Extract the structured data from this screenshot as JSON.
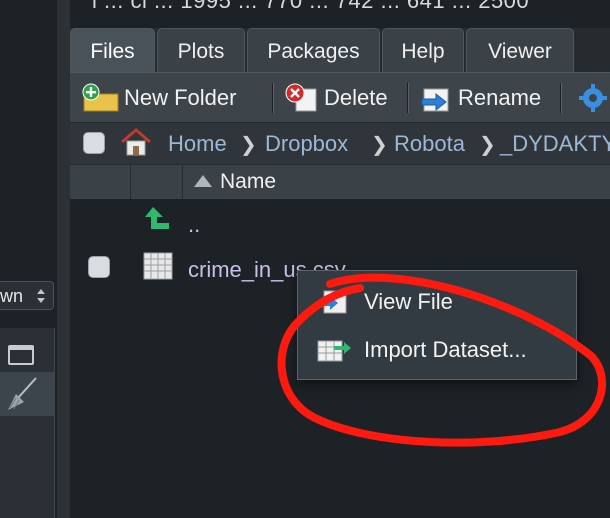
{
  "top_partial_text": "i ... ci ... 1995 ... 770 ... 742 ... 641 ... 2500",
  "left_pane": {
    "select_value": "wn",
    "window_icon": "window-icon",
    "broom_icon": "broom-icon"
  },
  "tabs": [
    {
      "label": "Files",
      "active": true
    },
    {
      "label": "Plots",
      "active": false
    },
    {
      "label": "Packages",
      "active": false
    },
    {
      "label": "Help",
      "active": false
    },
    {
      "label": "Viewer",
      "active": false
    }
  ],
  "toolbar": {
    "new_folder_label": "New Folder",
    "new_folder_icon": "new-folder-icon",
    "delete_label": "Delete",
    "delete_icon": "delete-icon",
    "rename_label": "Rename",
    "rename_icon": "rename-icon",
    "more_icon": "gear-icon"
  },
  "breadcrumb": {
    "home_icon": "home-icon",
    "items": [
      "Home",
      "Dropbox",
      "Robota",
      "_DYDAKTY"
    ]
  },
  "table": {
    "name_header": "Name",
    "rows": [
      {
        "name": "..",
        "icon": "up-arrow-icon",
        "has_checkbox": false
      },
      {
        "name": "crime_in_us.csv",
        "icon": "spreadsheet-icon",
        "has_checkbox": true
      }
    ]
  },
  "context_menu": {
    "items": [
      {
        "label": "View File",
        "icon": "view-file-icon"
      },
      {
        "label": "Import Dataset...",
        "icon": "import-dataset-icon"
      }
    ]
  },
  "colors": {
    "annotation_red": "#ff1a0f",
    "background": "#1d2227",
    "up_arrow_green": "#2fb86f"
  }
}
